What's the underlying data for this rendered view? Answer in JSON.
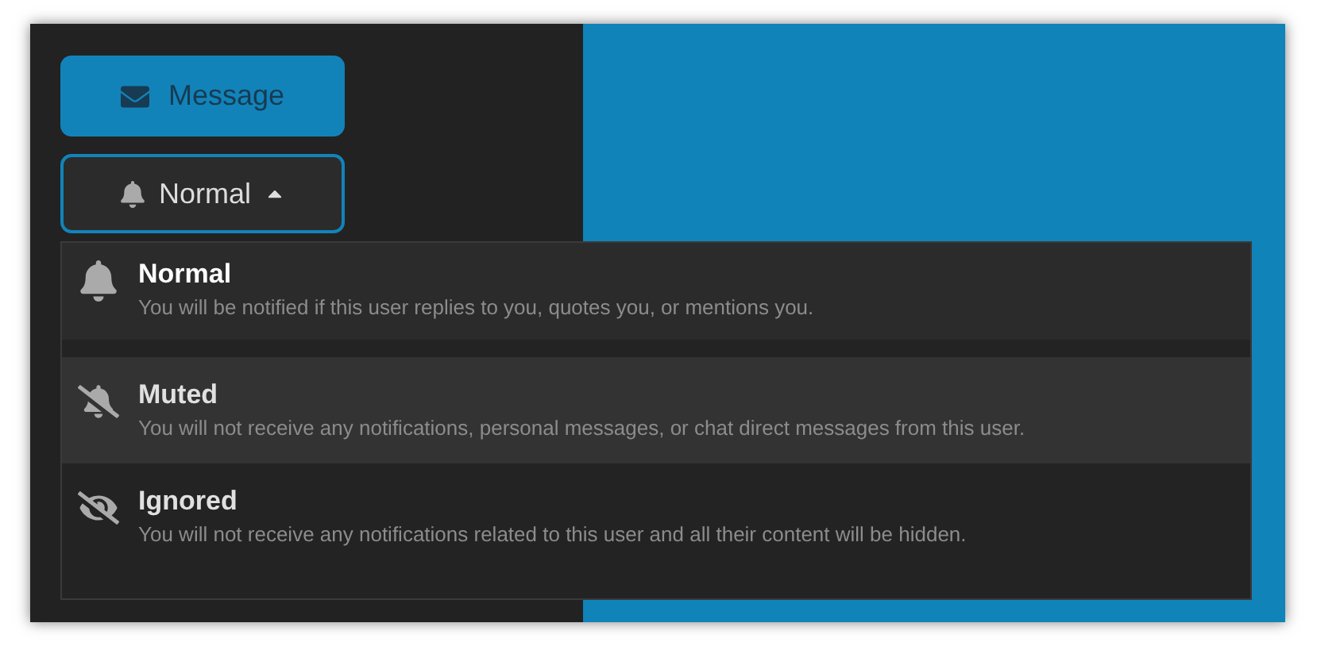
{
  "message_button": {
    "label": "Message"
  },
  "notification_button": {
    "label": "Normal",
    "expanded": true
  },
  "menu": [
    {
      "kind": "normal",
      "title": "Normal",
      "description": "You will be notified if this user replies to you, quotes you, or mentions you.",
      "selected": true,
      "hovered": false
    },
    {
      "kind": "muted",
      "title": "Muted",
      "description": "You will not receive any notifications, personal messages, or chat direct messages from this user.",
      "selected": false,
      "hovered": true
    },
    {
      "kind": "ignored",
      "title": "Ignored",
      "description": "You will not receive any notifications related to this user and all their content will be hidden.",
      "selected": false,
      "hovered": false
    }
  ]
}
